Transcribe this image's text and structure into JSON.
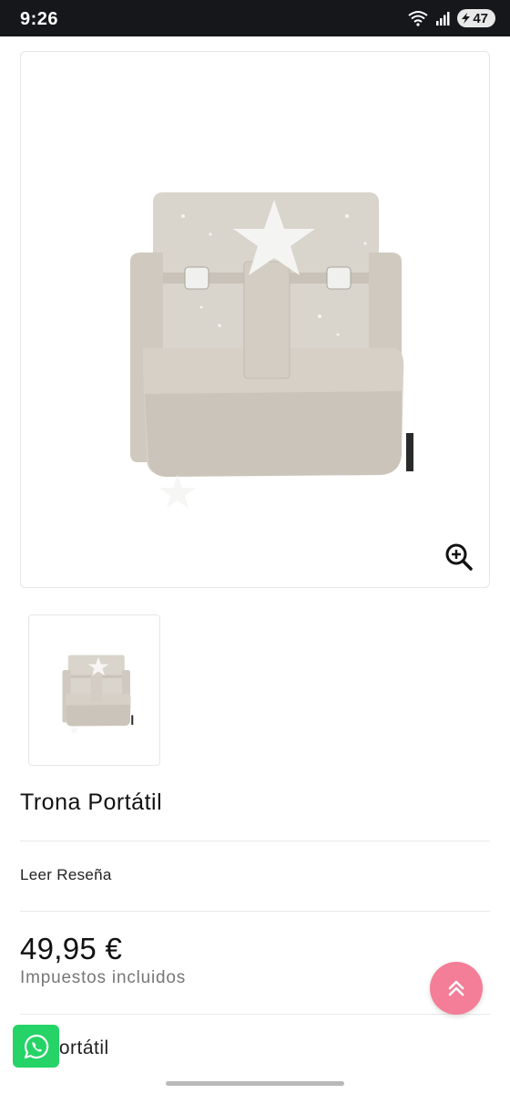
{
  "status_bar": {
    "time": "9:26",
    "battery": "47",
    "icons": [
      "wifi-icon",
      "signal-icon",
      "battery-icon"
    ]
  },
  "product": {
    "title": "Trona Portátil",
    "review_link": "Leer Reseña",
    "price": "49,95 €",
    "tax_note": "Impuestos incluidos",
    "description_visible": "na portátil"
  },
  "icons": [
    "zoom-in-icon",
    "scroll-to-top-icon",
    "whatsapp-icon"
  ],
  "colors": {
    "status_bar": "#16171b",
    "scroll_top_button": "#f47e97",
    "whatsapp": "#25d366",
    "product_fabric": "#d9d4cc"
  }
}
